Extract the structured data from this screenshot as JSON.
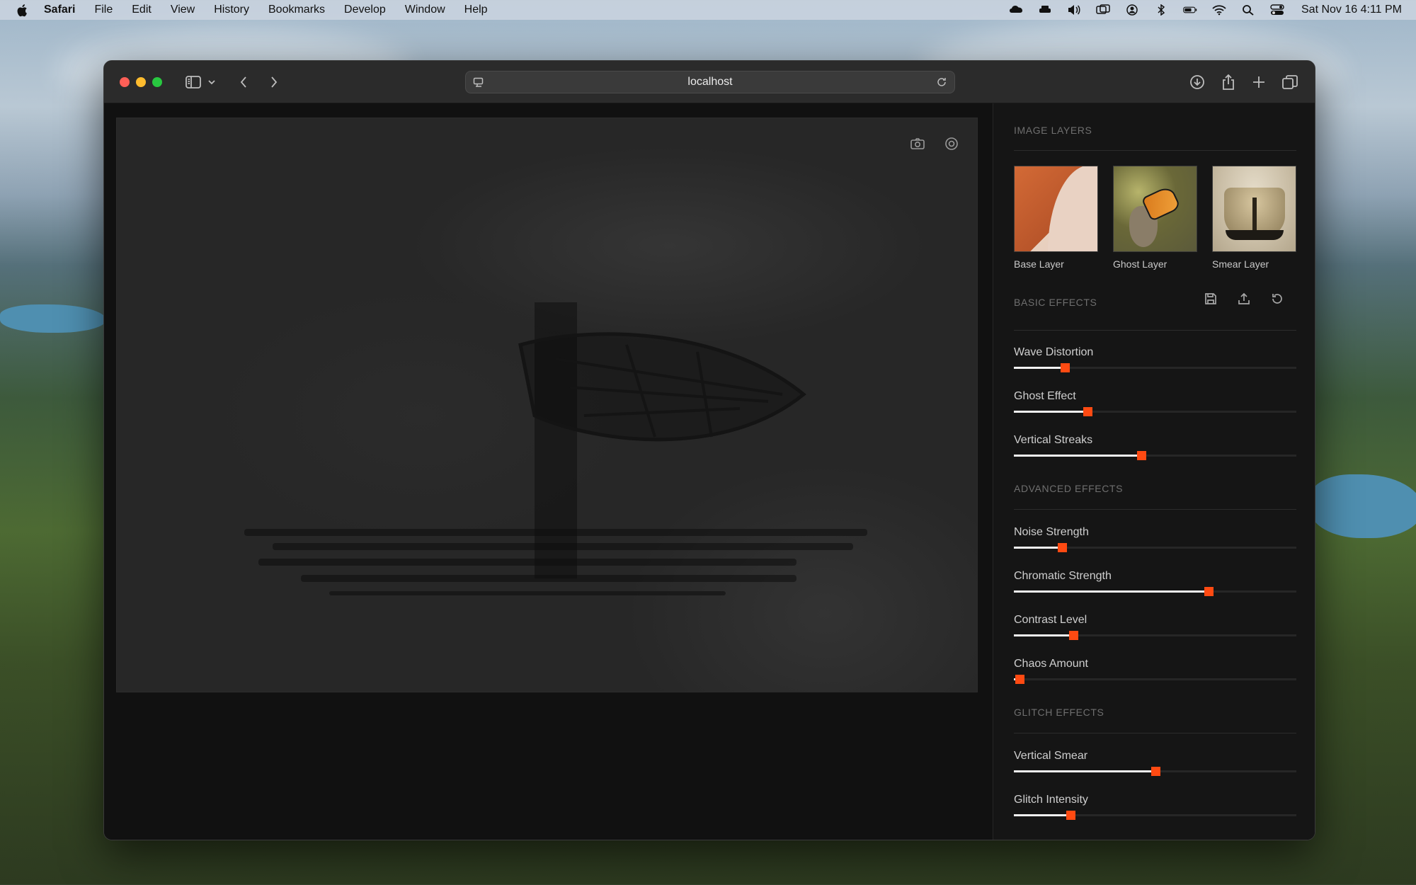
{
  "menubar": {
    "app": "Safari",
    "items": [
      "File",
      "Edit",
      "View",
      "History",
      "Bookmarks",
      "Develop",
      "Window",
      "Help"
    ],
    "clock": "Sat Nov 16  4:11 PM"
  },
  "browser": {
    "url": "localhost"
  },
  "sidebar": {
    "image_layers_title": "IMAGE LAYERS",
    "layers": [
      {
        "label": "Base Layer"
      },
      {
        "label": "Ghost Layer"
      },
      {
        "label": "Smear Layer"
      }
    ],
    "basic_title": "BASIC EFFECTS",
    "advanced_title": "ADVANCED EFFECTS",
    "glitch_title": "GLITCH EFFECTS",
    "basic": [
      {
        "label": "Wave Distortion",
        "value": 0.18
      },
      {
        "label": "Ghost Effect",
        "value": 0.26
      },
      {
        "label": "Vertical Streaks",
        "value": 0.45
      }
    ],
    "advanced": [
      {
        "label": "Noise Strength",
        "value": 0.17
      },
      {
        "label": "Chromatic Strength",
        "value": 0.69
      },
      {
        "label": "Contrast Level",
        "value": 0.21
      },
      {
        "label": "Chaos Amount",
        "value": 0.02
      }
    ],
    "glitch": [
      {
        "label": "Vertical Smear",
        "value": 0.5
      },
      {
        "label": "Glitch Intensity",
        "value": 0.2
      }
    ]
  },
  "colors": {
    "accent": "#ff4a12",
    "panel": "#151515"
  }
}
